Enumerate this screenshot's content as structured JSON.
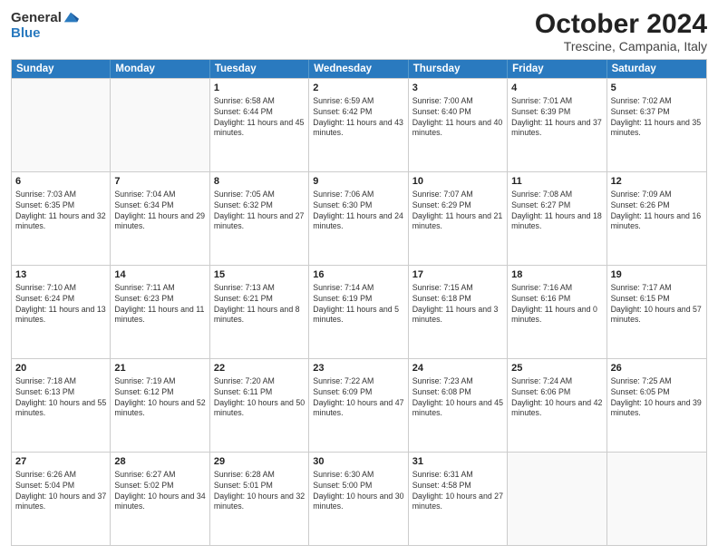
{
  "logo": {
    "general": "General",
    "blue": "Blue"
  },
  "header": {
    "month": "October 2024",
    "location": "Trescine, Campania, Italy"
  },
  "weekdays": [
    "Sunday",
    "Monday",
    "Tuesday",
    "Wednesday",
    "Thursday",
    "Friday",
    "Saturday"
  ],
  "weeks": [
    [
      {
        "day": "",
        "sunrise": "",
        "sunset": "",
        "daylight": "",
        "empty": true
      },
      {
        "day": "",
        "sunrise": "",
        "sunset": "",
        "daylight": "",
        "empty": true
      },
      {
        "day": "1",
        "sunrise": "Sunrise: 6:58 AM",
        "sunset": "Sunset: 6:44 PM",
        "daylight": "Daylight: 11 hours and 45 minutes.",
        "empty": false
      },
      {
        "day": "2",
        "sunrise": "Sunrise: 6:59 AM",
        "sunset": "Sunset: 6:42 PM",
        "daylight": "Daylight: 11 hours and 43 minutes.",
        "empty": false
      },
      {
        "day": "3",
        "sunrise": "Sunrise: 7:00 AM",
        "sunset": "Sunset: 6:40 PM",
        "daylight": "Daylight: 11 hours and 40 minutes.",
        "empty": false
      },
      {
        "day": "4",
        "sunrise": "Sunrise: 7:01 AM",
        "sunset": "Sunset: 6:39 PM",
        "daylight": "Daylight: 11 hours and 37 minutes.",
        "empty": false
      },
      {
        "day": "5",
        "sunrise": "Sunrise: 7:02 AM",
        "sunset": "Sunset: 6:37 PM",
        "daylight": "Daylight: 11 hours and 35 minutes.",
        "empty": false
      }
    ],
    [
      {
        "day": "6",
        "sunrise": "Sunrise: 7:03 AM",
        "sunset": "Sunset: 6:35 PM",
        "daylight": "Daylight: 11 hours and 32 minutes.",
        "empty": false
      },
      {
        "day": "7",
        "sunrise": "Sunrise: 7:04 AM",
        "sunset": "Sunset: 6:34 PM",
        "daylight": "Daylight: 11 hours and 29 minutes.",
        "empty": false
      },
      {
        "day": "8",
        "sunrise": "Sunrise: 7:05 AM",
        "sunset": "Sunset: 6:32 PM",
        "daylight": "Daylight: 11 hours and 27 minutes.",
        "empty": false
      },
      {
        "day": "9",
        "sunrise": "Sunrise: 7:06 AM",
        "sunset": "Sunset: 6:30 PM",
        "daylight": "Daylight: 11 hours and 24 minutes.",
        "empty": false
      },
      {
        "day": "10",
        "sunrise": "Sunrise: 7:07 AM",
        "sunset": "Sunset: 6:29 PM",
        "daylight": "Daylight: 11 hours and 21 minutes.",
        "empty": false
      },
      {
        "day": "11",
        "sunrise": "Sunrise: 7:08 AM",
        "sunset": "Sunset: 6:27 PM",
        "daylight": "Daylight: 11 hours and 18 minutes.",
        "empty": false
      },
      {
        "day": "12",
        "sunrise": "Sunrise: 7:09 AM",
        "sunset": "Sunset: 6:26 PM",
        "daylight": "Daylight: 11 hours and 16 minutes.",
        "empty": false
      }
    ],
    [
      {
        "day": "13",
        "sunrise": "Sunrise: 7:10 AM",
        "sunset": "Sunset: 6:24 PM",
        "daylight": "Daylight: 11 hours and 13 minutes.",
        "empty": false
      },
      {
        "day": "14",
        "sunrise": "Sunrise: 7:11 AM",
        "sunset": "Sunset: 6:23 PM",
        "daylight": "Daylight: 11 hours and 11 minutes.",
        "empty": false
      },
      {
        "day": "15",
        "sunrise": "Sunrise: 7:13 AM",
        "sunset": "Sunset: 6:21 PM",
        "daylight": "Daylight: 11 hours and 8 minutes.",
        "empty": false
      },
      {
        "day": "16",
        "sunrise": "Sunrise: 7:14 AM",
        "sunset": "Sunset: 6:19 PM",
        "daylight": "Daylight: 11 hours and 5 minutes.",
        "empty": false
      },
      {
        "day": "17",
        "sunrise": "Sunrise: 7:15 AM",
        "sunset": "Sunset: 6:18 PM",
        "daylight": "Daylight: 11 hours and 3 minutes.",
        "empty": false
      },
      {
        "day": "18",
        "sunrise": "Sunrise: 7:16 AM",
        "sunset": "Sunset: 6:16 PM",
        "daylight": "Daylight: 11 hours and 0 minutes.",
        "empty": false
      },
      {
        "day": "19",
        "sunrise": "Sunrise: 7:17 AM",
        "sunset": "Sunset: 6:15 PM",
        "daylight": "Daylight: 10 hours and 57 minutes.",
        "empty": false
      }
    ],
    [
      {
        "day": "20",
        "sunrise": "Sunrise: 7:18 AM",
        "sunset": "Sunset: 6:13 PM",
        "daylight": "Daylight: 10 hours and 55 minutes.",
        "empty": false
      },
      {
        "day": "21",
        "sunrise": "Sunrise: 7:19 AM",
        "sunset": "Sunset: 6:12 PM",
        "daylight": "Daylight: 10 hours and 52 minutes.",
        "empty": false
      },
      {
        "day": "22",
        "sunrise": "Sunrise: 7:20 AM",
        "sunset": "Sunset: 6:11 PM",
        "daylight": "Daylight: 10 hours and 50 minutes.",
        "empty": false
      },
      {
        "day": "23",
        "sunrise": "Sunrise: 7:22 AM",
        "sunset": "Sunset: 6:09 PM",
        "daylight": "Daylight: 10 hours and 47 minutes.",
        "empty": false
      },
      {
        "day": "24",
        "sunrise": "Sunrise: 7:23 AM",
        "sunset": "Sunset: 6:08 PM",
        "daylight": "Daylight: 10 hours and 45 minutes.",
        "empty": false
      },
      {
        "day": "25",
        "sunrise": "Sunrise: 7:24 AM",
        "sunset": "Sunset: 6:06 PM",
        "daylight": "Daylight: 10 hours and 42 minutes.",
        "empty": false
      },
      {
        "day": "26",
        "sunrise": "Sunrise: 7:25 AM",
        "sunset": "Sunset: 6:05 PM",
        "daylight": "Daylight: 10 hours and 39 minutes.",
        "empty": false
      }
    ],
    [
      {
        "day": "27",
        "sunrise": "Sunrise: 6:26 AM",
        "sunset": "Sunset: 5:04 PM",
        "daylight": "Daylight: 10 hours and 37 minutes.",
        "empty": false
      },
      {
        "day": "28",
        "sunrise": "Sunrise: 6:27 AM",
        "sunset": "Sunset: 5:02 PM",
        "daylight": "Daylight: 10 hours and 34 minutes.",
        "empty": false
      },
      {
        "day": "29",
        "sunrise": "Sunrise: 6:28 AM",
        "sunset": "Sunset: 5:01 PM",
        "daylight": "Daylight: 10 hours and 32 minutes.",
        "empty": false
      },
      {
        "day": "30",
        "sunrise": "Sunrise: 6:30 AM",
        "sunset": "Sunset: 5:00 PM",
        "daylight": "Daylight: 10 hours and 30 minutes.",
        "empty": false
      },
      {
        "day": "31",
        "sunrise": "Sunrise: 6:31 AM",
        "sunset": "Sunset: 4:58 PM",
        "daylight": "Daylight: 10 hours and 27 minutes.",
        "empty": false
      },
      {
        "day": "",
        "sunrise": "",
        "sunset": "",
        "daylight": "",
        "empty": true
      },
      {
        "day": "",
        "sunrise": "",
        "sunset": "",
        "daylight": "",
        "empty": true
      }
    ]
  ]
}
